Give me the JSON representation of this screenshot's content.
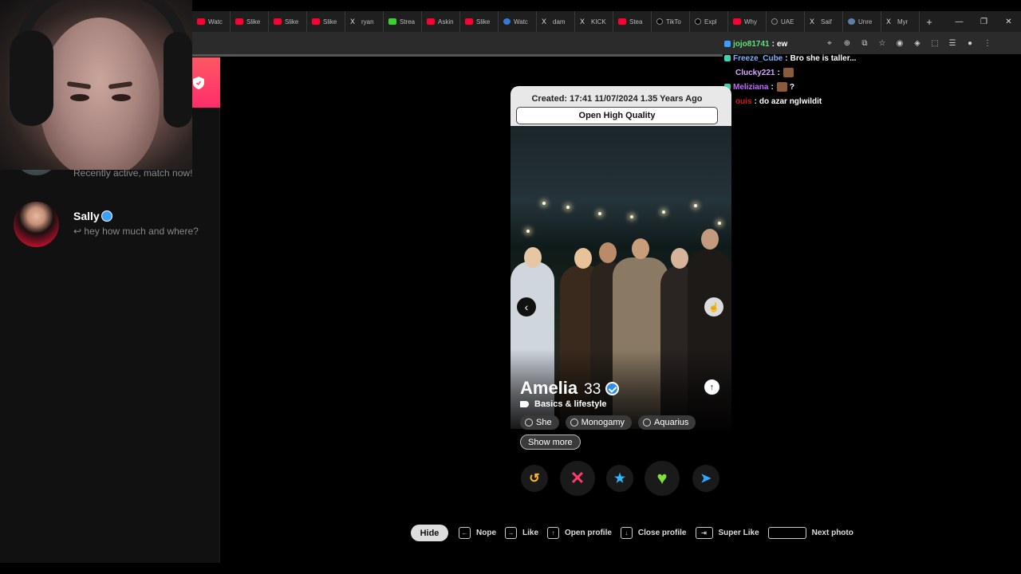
{
  "browser": {
    "tabs": [
      {
        "label": "Watc",
        "icon": "youtube-icon",
        "fav": "yt"
      },
      {
        "label": "Slike",
        "icon": "youtube-icon",
        "fav": "yt"
      },
      {
        "label": "Slike",
        "icon": "youtube-icon",
        "fav": "yt"
      },
      {
        "label": "Slike",
        "icon": "youtube-icon",
        "fav": "yt"
      },
      {
        "label": "ryan",
        "icon": "x-icon",
        "fav": "x"
      },
      {
        "label": "Strea",
        "icon": "kick-icon",
        "fav": "k"
      },
      {
        "label": "Askin",
        "icon": "youtube-icon",
        "fav": "yt"
      },
      {
        "label": "Slike",
        "icon": "youtube-icon",
        "fav": "yt"
      },
      {
        "label": "Watc",
        "icon": "messenger-icon",
        "fav": "ms"
      },
      {
        "label": "dam",
        "icon": "x-icon",
        "fav": "x"
      },
      {
        "label": "KICK",
        "icon": "x-icon",
        "fav": "x"
      },
      {
        "label": "Stea",
        "icon": "youtube-icon",
        "fav": "yt"
      },
      {
        "label": "TikTo",
        "icon": "tiktok-icon",
        "fav": "tt"
      },
      {
        "label": "Expl",
        "icon": "tiktok-icon",
        "fav": "tt"
      },
      {
        "label": "Why",
        "icon": "youtube-icon",
        "fav": "yt"
      },
      {
        "label": "UAE",
        "icon": "tiktok-icon",
        "fav": "uae"
      },
      {
        "label": "Saif",
        "icon": "x-icon",
        "fav": "x"
      },
      {
        "label": "Unre",
        "icon": "steam-icon",
        "fav": "steam"
      },
      {
        "label": "Myr",
        "icon": "x-icon",
        "fav": "x"
      }
    ],
    "new_tab": "+",
    "window_controls": {
      "minimize": "—",
      "restore": "❐",
      "close": "✕"
    }
  },
  "chat": [
    {
      "user": "jojo81741",
      "color": "#5fe07a",
      "message": "ew",
      "icon_color": "#3aa0ff"
    },
    {
      "user": "Freeze_Cube",
      "color": "#7fb6ff",
      "message": "Bro she is taller...",
      "icon_color": "#38d4b0"
    },
    {
      "user": "Clucky221",
      "color": "#d9a6ff",
      "message": "",
      "emote": true,
      "icon_color": ""
    },
    {
      "user": "Meliziana",
      "color": "#c36bff",
      "message": "?",
      "emote": true,
      "icon_color": "#38d4b0"
    },
    {
      "user": "ouis",
      "color": "#d41a1a",
      "message": "do azar nglwildit",
      "icon_color": ""
    }
  ],
  "sidebar": {
    "messages": [
      {
        "name": "",
        "preview": "Recently active, match now!"
      },
      {
        "name": "Sally",
        "preview": "↩ hey how much and where?"
      }
    ]
  },
  "card": {
    "created": "Created: 17:41 11/07/2024 1.35 Years Ago",
    "hq_button": "Open High Quality",
    "name": "Amelia",
    "age": "33",
    "basics": "Basics & lifestyle",
    "pills": [
      "She",
      "Monogamy",
      "Aquarius"
    ],
    "show_more": "Show more",
    "actions": {
      "rewind": "↺",
      "nope": "✕",
      "superlike": "★",
      "like": "♥",
      "boost": "➤"
    }
  },
  "hints": {
    "hide": "Hide",
    "items": [
      {
        "key": "←",
        "label": "Nope"
      },
      {
        "key": "→",
        "label": "Like"
      },
      {
        "key": "↑",
        "label": "Open profile"
      },
      {
        "key": "↓",
        "label": "Close profile"
      },
      {
        "key": "⇥",
        "label": "Super Like"
      },
      {
        "key": "",
        "label": "Next photo"
      }
    ]
  },
  "colors": {
    "tinder_red": "#fd5864",
    "nope": "#ff3b6e",
    "superlike": "#2fb9ff",
    "like": "#7fe03c",
    "rewind": "#ffb628"
  }
}
